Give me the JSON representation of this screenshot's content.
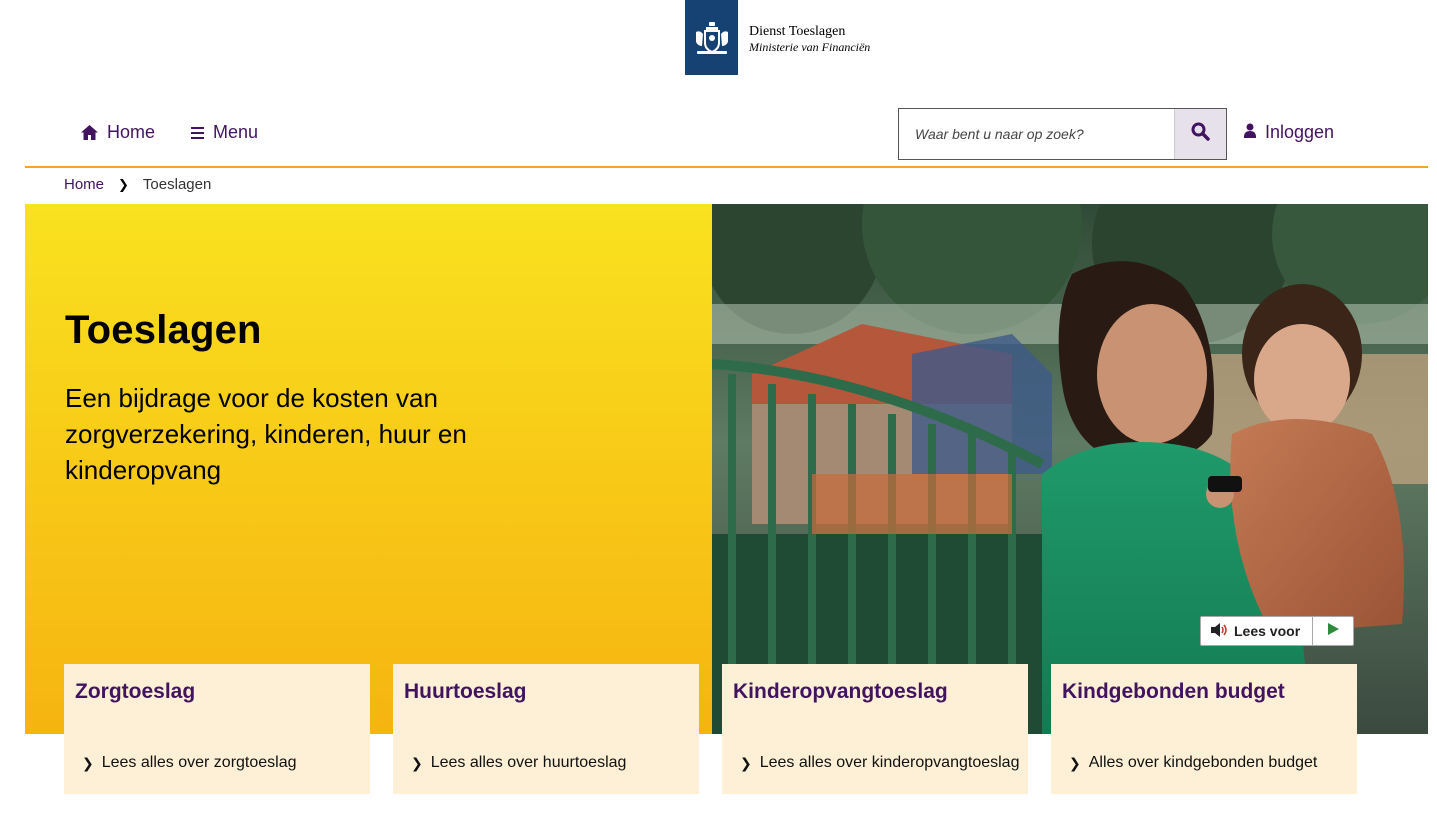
{
  "logo": {
    "org_name": "Dienst Toeslagen",
    "ministry": "Ministerie van Financiën"
  },
  "nav": {
    "home_label": "Home",
    "menu_label": "Menu",
    "login_label": "Inloggen"
  },
  "search": {
    "placeholder": "Waar bent u naar op zoek?",
    "value": ""
  },
  "breadcrumb": {
    "home": "Home",
    "current": "Toeslagen"
  },
  "hero": {
    "title": "Toeslagen",
    "subtitle": "Een bijdrage voor de kosten van zorgverzekering, kinderen, huur en kinderopvang"
  },
  "lees_voor": {
    "label": "Lees voor"
  },
  "cards": [
    {
      "title": "Zorgtoeslag",
      "link": "Lees alles over zorgtoeslag"
    },
    {
      "title": "Huurtoeslag",
      "link": "Lees alles over huurtoeslag"
    },
    {
      "title": "Kinderopvangtoeslag",
      "link": "Lees alles over kinderopvangtoeslag"
    },
    {
      "title": "Kindgebonden budget",
      "link": "Alles over kindgebonden budget"
    }
  ],
  "colors": {
    "brand_purple": "#42145f",
    "logo_blue": "#154273",
    "accent_orange": "#f5a623",
    "hero_yellow": "#f9e21f",
    "card_bg": "#fdf0d6"
  },
  "icons": {
    "home": "home-icon",
    "menu": "hamburger-icon",
    "search": "search-icon",
    "login": "user-icon",
    "speaker": "speaker-icon",
    "play": "play-icon",
    "chevron": "chevron-right-icon"
  }
}
